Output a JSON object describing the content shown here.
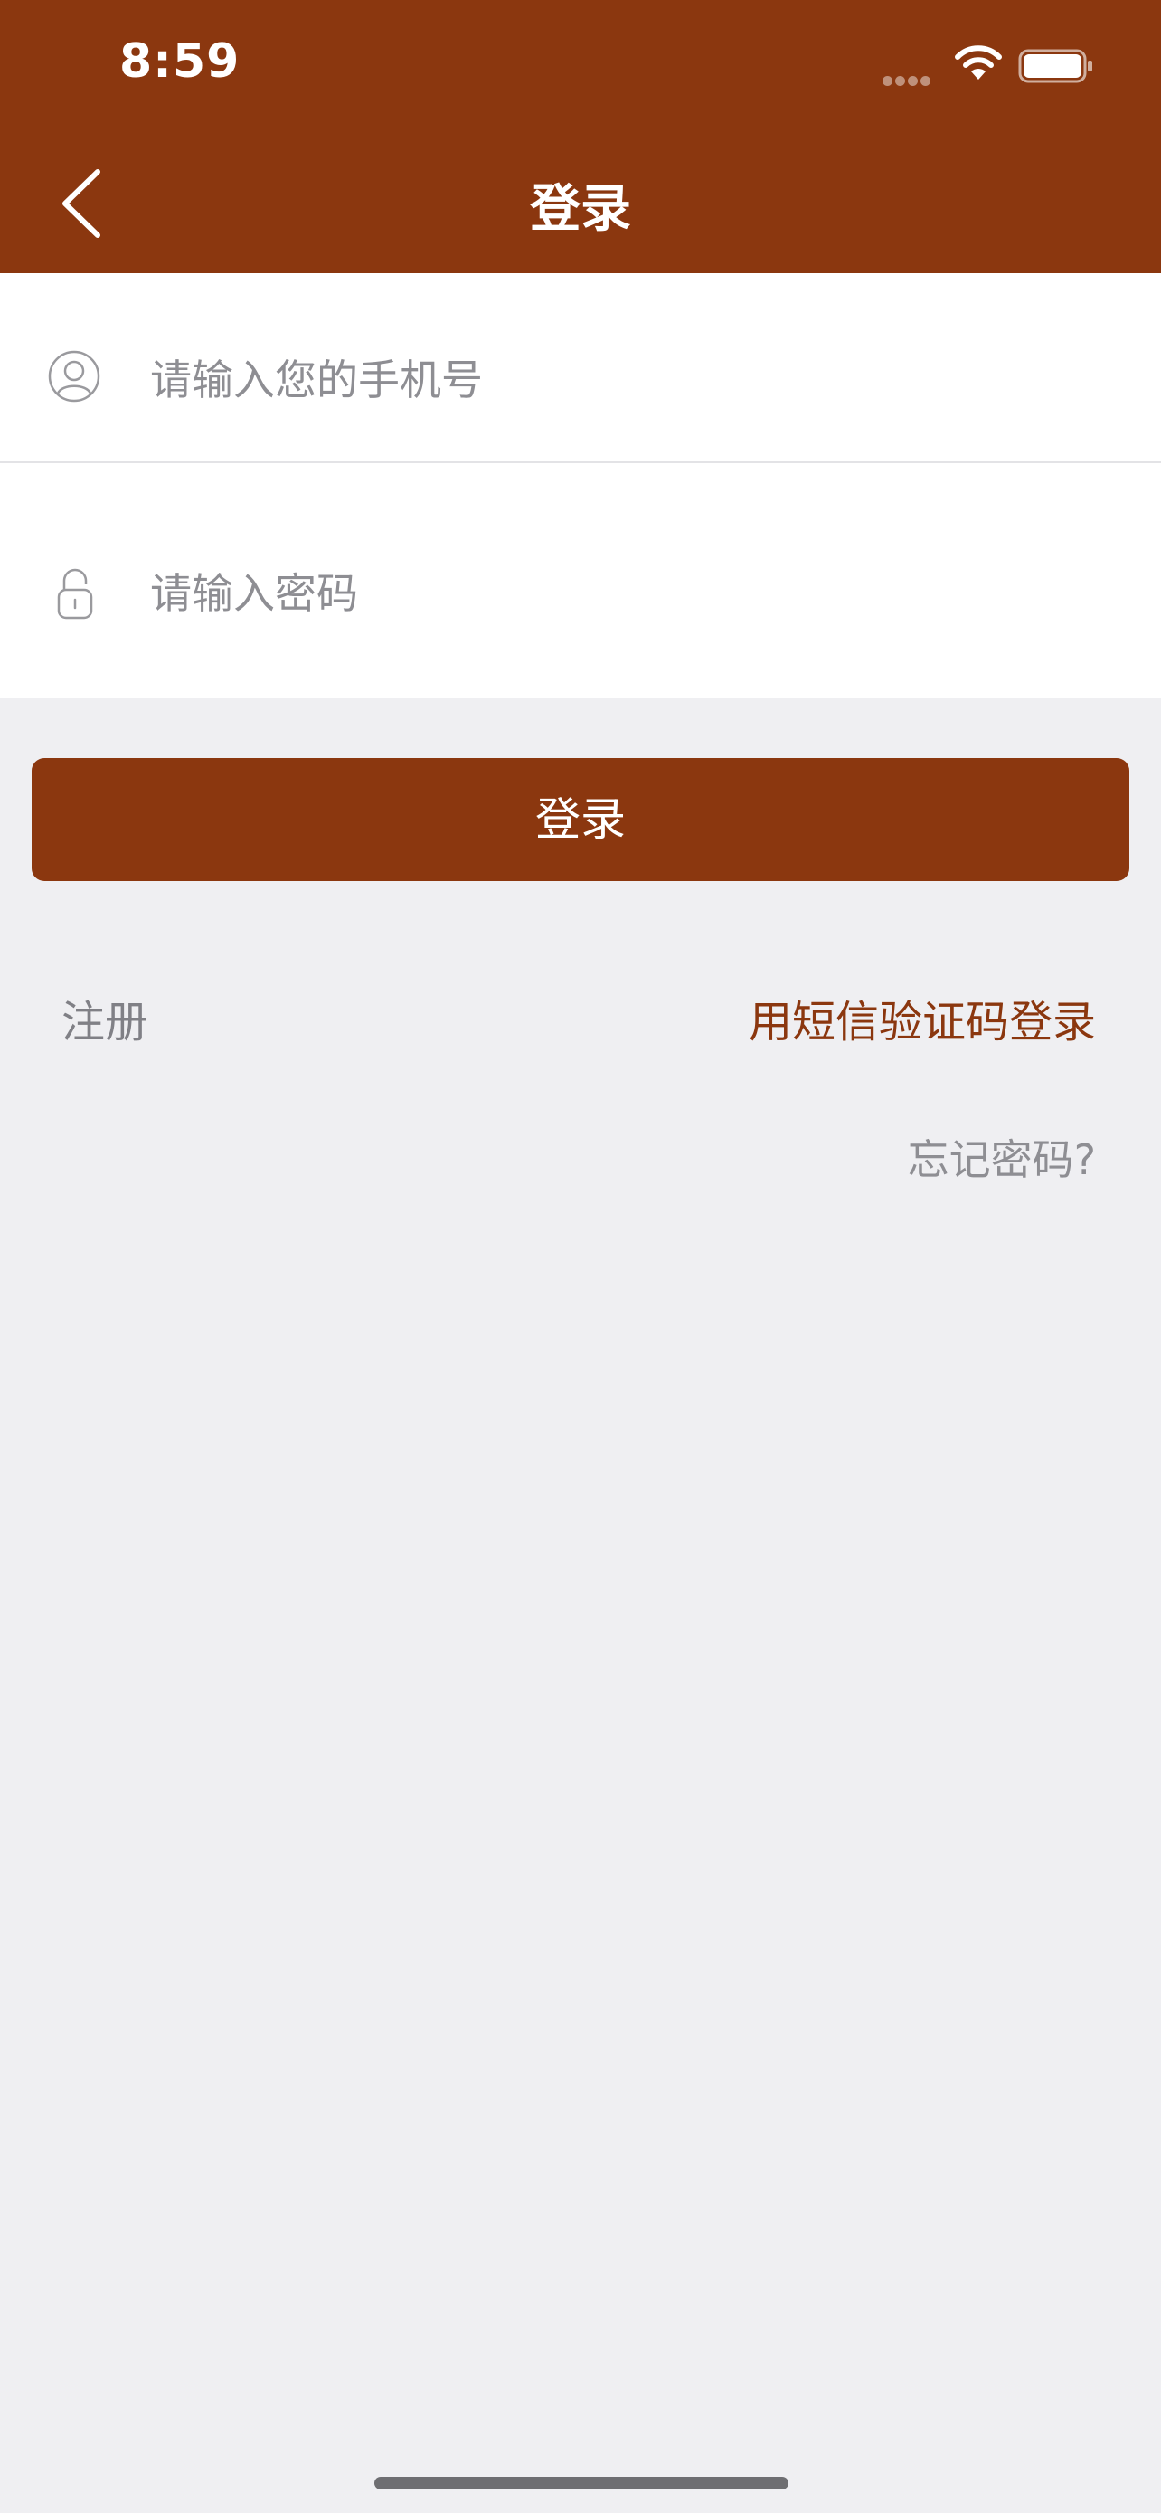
{
  "status_bar": {
    "time": "8:59"
  },
  "nav": {
    "title": "登录"
  },
  "form": {
    "phone_placeholder": "请输入您的手机号",
    "password_placeholder": "请输入密码"
  },
  "actions": {
    "login_label": "登录",
    "register_label": "注册",
    "sms_login_label": "用短信验证码登录",
    "forgot_label": "忘记密码?"
  },
  "colors": {
    "brand": "#8b370f",
    "background": "#efeff2",
    "secondary_text": "#8e8e93"
  },
  "icons": {
    "back": "chevron-left-icon",
    "phone": "user-icon",
    "password": "lock-icon",
    "wifi": "wifi-icon",
    "battery": "battery-icon",
    "signal": "signal-icon"
  }
}
